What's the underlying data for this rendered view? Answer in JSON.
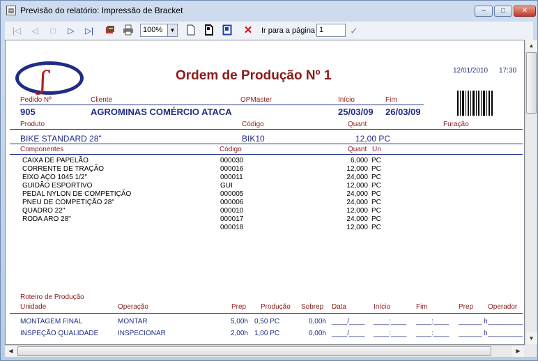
{
  "window": {
    "title": "Previsão do relatório: Impressão de Bracket",
    "app_icon": "report-icon",
    "minimize_glyph": "–",
    "maximize_glyph": "□",
    "close_glyph": "✕"
  },
  "toolbar": {
    "first_glyph": "|◁",
    "prev_glyph": "◁",
    "stop_glyph": "□",
    "next_glyph": "▷",
    "last_glyph": "▷|",
    "zoom_value": "100%",
    "goto_label": "Ir para a página",
    "goto_value": "1",
    "delete_glyph": "✕",
    "confirm_glyph": "✓"
  },
  "report": {
    "title": "Ordem de Produção Nº 1",
    "date": "12/01/2010",
    "time": "17:30",
    "header_labels": {
      "pedido": "Pedido Nº",
      "cliente": "Cliente",
      "opmaster": "OPMaster",
      "inicio": "Início",
      "fim": "Fim"
    },
    "header_values": {
      "pedido": "905",
      "cliente": "AGROMINAS COMÉRCIO ATACA",
      "inicio": "25/03/09",
      "fim": "26/03/09"
    },
    "product_labels": {
      "produto": "Produto",
      "codigo": "Código",
      "quant": "Quant",
      "furacao": "Furação"
    },
    "product": {
      "name": "BIKE STANDARD 28\"",
      "code": "BIK10",
      "quant": "12,00 PC"
    },
    "components_labels": {
      "componentes": "Componentes",
      "codigo": "Código",
      "quant": "Quant",
      "un": "Un"
    },
    "components": [
      {
        "name": "CAIXA DE PAPELÃO",
        "code": "000030",
        "quant": "6,000",
        "un": "PC"
      },
      {
        "name": "CORRENTE DE TRAÇÃO",
        "code": "000016",
        "quant": "12,000",
        "un": "PC"
      },
      {
        "name": "EIXO AÇO 1045 1/2\"",
        "code": "000011",
        "quant": "24,000",
        "un": "PC"
      },
      {
        "name": "GUIDÃO ESPORTIVO",
        "code": "GUI",
        "quant": "12,000",
        "un": "PC"
      },
      {
        "name": "PEDAL NYLON DE COMPETIÇÃO",
        "code": "000005",
        "quant": "24,000",
        "un": "PC"
      },
      {
        "name": "PNEU DE COMPETIÇÃO 28\"",
        "code": "000006",
        "quant": "24,000",
        "un": "PC"
      },
      {
        "name": "QUADRO 22\"",
        "code": "000010",
        "quant": "12,000",
        "un": "PC"
      },
      {
        "name": "RODA ARO 28\"",
        "code": "000017",
        "quant": "24,000",
        "un": "PC"
      },
      {
        "name": "",
        "code": "000018",
        "quant": "12,000",
        "un": "PC"
      }
    ],
    "roteiro": {
      "section_label": "Roteiro de Produção",
      "columns": {
        "unidade": "Unidade",
        "operacao": "Operação",
        "prep": "Prep",
        "producao": "Produção",
        "sobrep": "Sobrep",
        "data": "Data",
        "inicio": "Início",
        "fim": "Fim",
        "prep2": "Prep",
        "operador": "Operador"
      },
      "rows": [
        {
          "unidade": "MONTAGEM FINAL",
          "operacao": "MONTAR",
          "prep": "5,00h",
          "producao": "0,50 PC",
          "sobrep": "0,00h",
          "data": "____/____",
          "inicio": "____:____",
          "fim": "____:____",
          "prep2": "______ h",
          "operador": "_________"
        },
        {
          "unidade": "INSPEÇÃO QUALIDADE",
          "operacao": "INSPECIONAR",
          "prep": "2,00h",
          "producao": "1,00 PC",
          "sobrep": "0,00h",
          "data": "____/____",
          "inicio": "____:____",
          "fim": "____:____",
          "prep2": "______ h",
          "operador": "_________"
        }
      ]
    }
  },
  "scrollbars": {
    "up_glyph": "▲",
    "down_glyph": "▼",
    "left_glyph": "◀",
    "right_glyph": "▶"
  }
}
